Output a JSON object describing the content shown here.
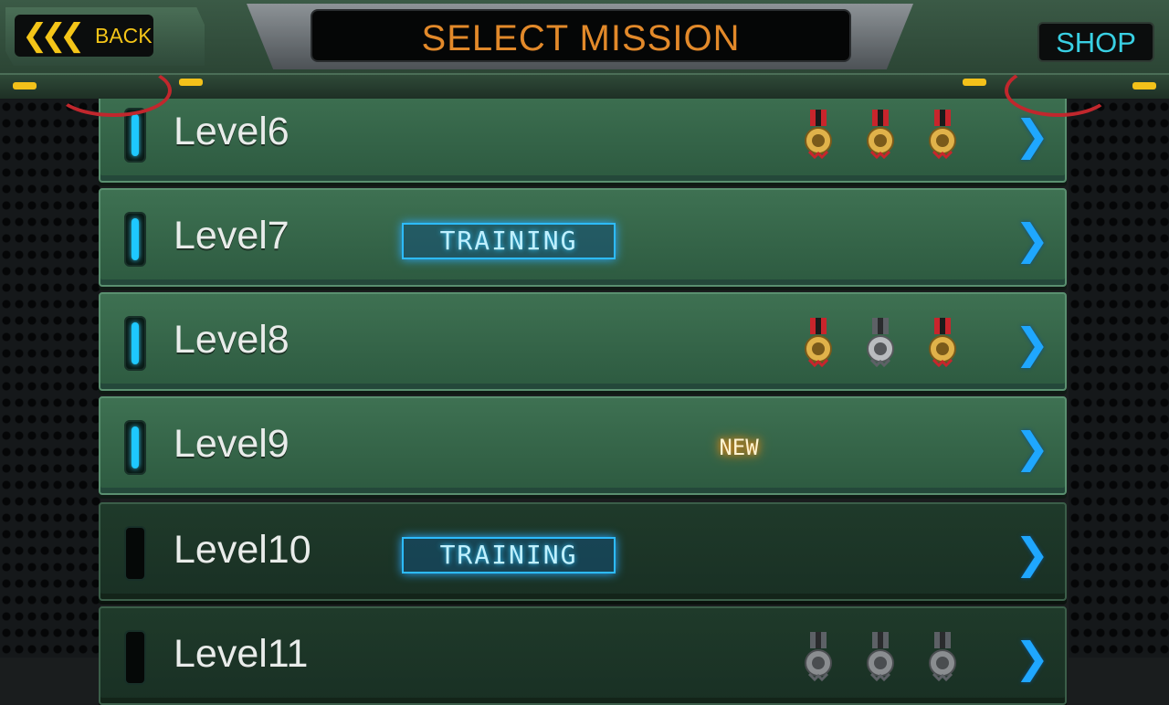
{
  "header": {
    "back_label": "BACK",
    "title": "SELECT MISSION",
    "shop_label": "SHOP"
  },
  "colors": {
    "accent_orange": "#e2892a",
    "accent_yellow": "#f4c518",
    "accent_cyan": "#39d0e4",
    "row_green": "#3e7152",
    "row_locked": "#1f3a2a"
  },
  "levels": [
    {
      "label": "Level6",
      "badge": "",
      "medals": [
        "gold",
        "gold",
        "gold"
      ],
      "locked": false
    },
    {
      "label": "Level7",
      "badge": "TRAINING",
      "medals": [],
      "locked": false
    },
    {
      "label": "Level8",
      "badge": "",
      "medals": [
        "gold",
        "silver",
        "gold"
      ],
      "locked": false
    },
    {
      "label": "Level9",
      "badge": "NEW",
      "medals": [],
      "locked": false
    },
    {
      "label": "Level10",
      "badge": "TRAINING",
      "medals": [],
      "locked": true
    },
    {
      "label": "Level11",
      "badge": "",
      "medals": [
        "gray",
        "gray",
        "gray"
      ],
      "locked": true
    }
  ],
  "icons": {
    "row_arrow": "chevron-right-icon",
    "medal": "medal-icon"
  }
}
